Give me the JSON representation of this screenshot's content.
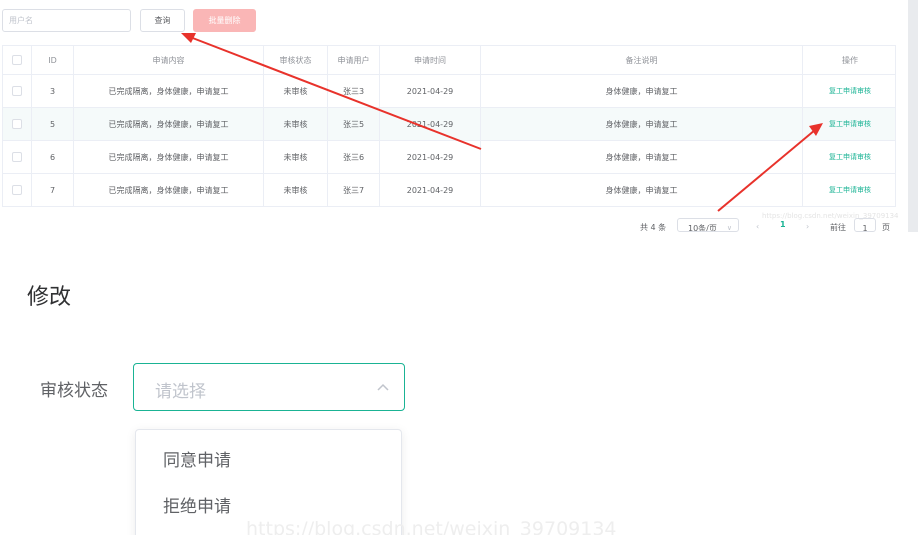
{
  "toolbar": {
    "search_placeholder": "用户名",
    "query_label": "查询",
    "batch_delete_label": "批量删除"
  },
  "table": {
    "headers": [
      "ID",
      "申请内容",
      "审核状态",
      "申请用户",
      "申请时间",
      "备注说明",
      "操作"
    ],
    "rows": [
      {
        "id": "3",
        "content": "已完成隔离，身体健康，申请复工",
        "status": "未审核",
        "user": "张三3",
        "time": "2021-04-29",
        "note": "身体健康，申请复工",
        "action": "复工申请审核"
      },
      {
        "id": "5",
        "content": "已完成隔离，身体健康，申请复工",
        "status": "未审核",
        "user": "张三5",
        "time": "2021-04-29",
        "note": "身体健康，申请复工",
        "action": "复工申请审核"
      },
      {
        "id": "6",
        "content": "已完成隔离，身体健康，申请复工",
        "status": "未审核",
        "user": "张三6",
        "time": "2021-04-29",
        "note": "身体健康，申请复工",
        "action": "复工申请审核"
      },
      {
        "id": "7",
        "content": "已完成隔离，身体健康，申请复工",
        "status": "未审核",
        "user": "张三7",
        "time": "2021-04-29",
        "note": "身体健康，申请复工",
        "action": "复工申请审核"
      }
    ]
  },
  "pagination": {
    "total": "共 4 条",
    "page_size": "10条/页",
    "current_page": "1",
    "goto_label": "前往",
    "goto_value": "1",
    "unit": "页"
  },
  "watermark_small": "https://blog.csdn.net/weixin_39709134",
  "watermark_big": "https://blog.csdn.net/weixin_39709134",
  "edit": {
    "title": "修改",
    "status_label": "审核状态",
    "select_placeholder": "请选择",
    "options": [
      "同意申请",
      "拒绝申请"
    ]
  },
  "colors": {
    "accent": "#1ab394",
    "danger_light": "#fab6b6",
    "arrow": "#e8322b"
  },
  "icons": {
    "select_arrow": "chevron-up-icon"
  }
}
